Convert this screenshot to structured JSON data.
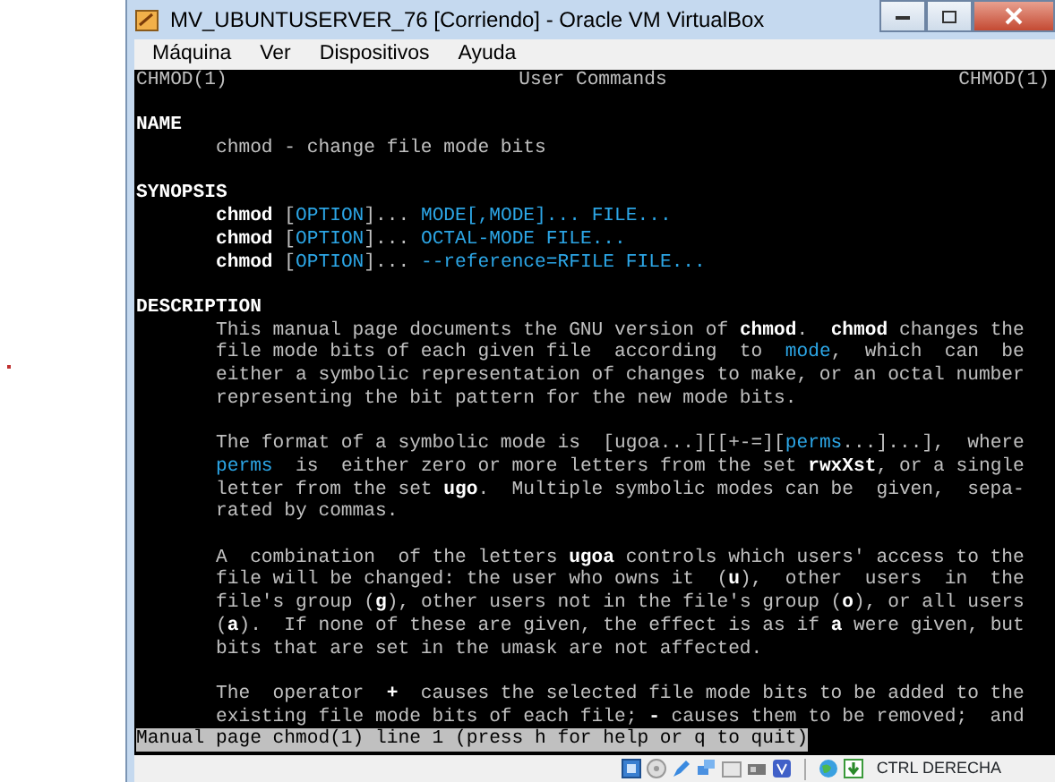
{
  "window": {
    "title": "MV_UBUNTUSERVER_76 [Corriendo] - Oracle VM VirtualBox"
  },
  "menu": [
    "Máquina",
    "Ver",
    "Dispositivos",
    "Ayuda"
  ],
  "terminal": {
    "header": {
      "left": "CHMOD(1)",
      "center": "User Commands",
      "right": "CHMOD(1)"
    },
    "sections": [
      {
        "heading": "NAME",
        "paragraphs": [
          [
            "chmod - change file mode bits"
          ]
        ]
      },
      {
        "heading": "SYNOPSIS",
        "paragraphs": [
          [
            "**chmod** [*OPTION*]... *MODE[,MODE]... FILE...*",
            "**chmod** [*OPTION*]... *OCTAL-MODE FILE...*",
            "**chmod** [*OPTION*]... *--reference=RFILE FILE...*"
          ]
        ]
      },
      {
        "heading": "DESCRIPTION",
        "paragraphs": [
          [
            "This manual page documents the GNU version of **chmod**.  **chmod** changes the",
            "file mode bits of each given file  according  to  *mode*,  which  can  be",
            "either a symbolic representation of changes to make, or an octal number",
            "representing the bit pattern for the new mode bits."
          ],
          [
            "The format of a symbolic mode is  [ugoa...][[+-=][*perms*...]...],  where",
            "*perms*  is  either zero or more letters from the set **rwxXst**, or a single",
            "letter from the set **ugo**.  Multiple symbolic modes can be  given,  sepa-",
            "rated by commas."
          ],
          [
            "A  combination  of the letters **ugoa** controls which users' access to the",
            "file will be changed: the user who owns it  (**u**),  other  users  in  the",
            "file's group (**g**), other users not in the file's group (**o**), or all users",
            "(**a**).  If none of these are given, the effect is as if **a** were given, but",
            "bits that are set in the umask are not affected."
          ],
          [
            "The  operator  **+**  causes the selected file mode bits to be added to the",
            "existing file mode bits of each file; **-** causes them to be removed;  and"
          ]
        ]
      }
    ],
    "pager_prompt": "Manual page chmod(1) line 1 (press h for help or q to quit)"
  },
  "status_bar": {
    "host_key": "CTRL DERECHA"
  }
}
